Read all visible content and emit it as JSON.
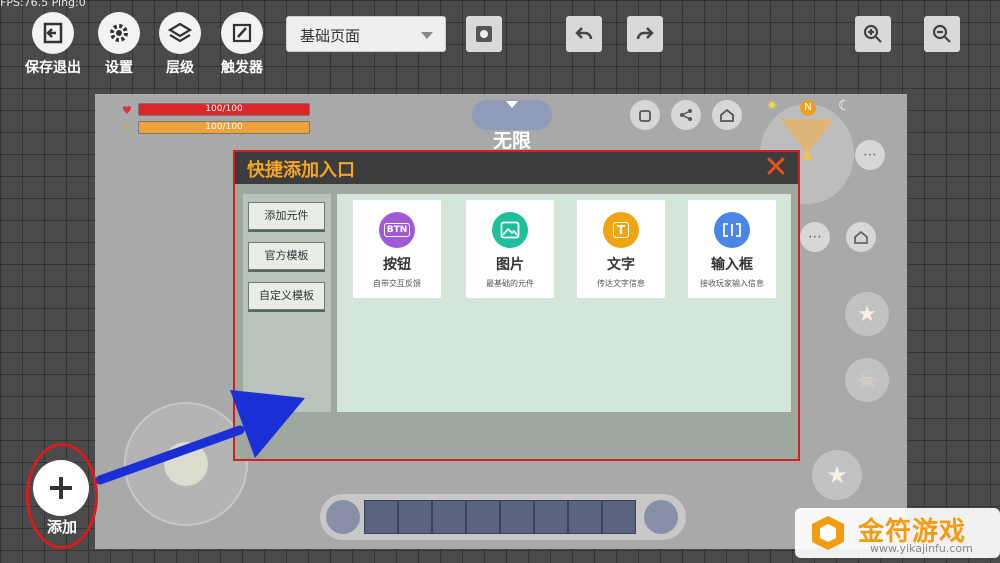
{
  "status": {
    "fps_text": "FPS:76.5  Ping:0"
  },
  "toolbar": {
    "buttons": [
      {
        "label": "保存退出",
        "icon": "exit-icon"
      },
      {
        "label": "设置",
        "icon": "gear-icon"
      },
      {
        "label": "层级",
        "icon": "layers-icon"
      },
      {
        "label": "触发器",
        "icon": "trigger-icon"
      }
    ],
    "page_select": {
      "value": "基础页面"
    }
  },
  "hud": {
    "health": "100/100",
    "stamina": "100/100",
    "mode_label": "无限"
  },
  "dialog": {
    "title": "快捷添加入口",
    "close_icon": "close-icon",
    "tabs": [
      "添加元件",
      "官方模板",
      "自定义模板"
    ],
    "cards": [
      {
        "title": "按钮",
        "desc": "自带交互反馈",
        "icon_text": "BTN",
        "color": "#a05ad6"
      },
      {
        "title": "图片",
        "desc": "最基础的元件",
        "icon_text": "",
        "color": "#1fbf9a"
      },
      {
        "title": "文字",
        "desc": "传达文字信息",
        "icon_text": "T",
        "color": "#f0a40e"
      },
      {
        "title": "输入框",
        "desc": "接收玩家输入信息",
        "icon_text": "",
        "color": "#4a86e8"
      }
    ]
  },
  "add_button": {
    "label": "添加"
  },
  "watermark": {
    "title": "金符游戏",
    "url": "www.yikajinfu.com"
  },
  "colors": {
    "highlight": "#d81b1b",
    "arrow": "#1a2fd6",
    "dialog_title": "#f5a623"
  }
}
